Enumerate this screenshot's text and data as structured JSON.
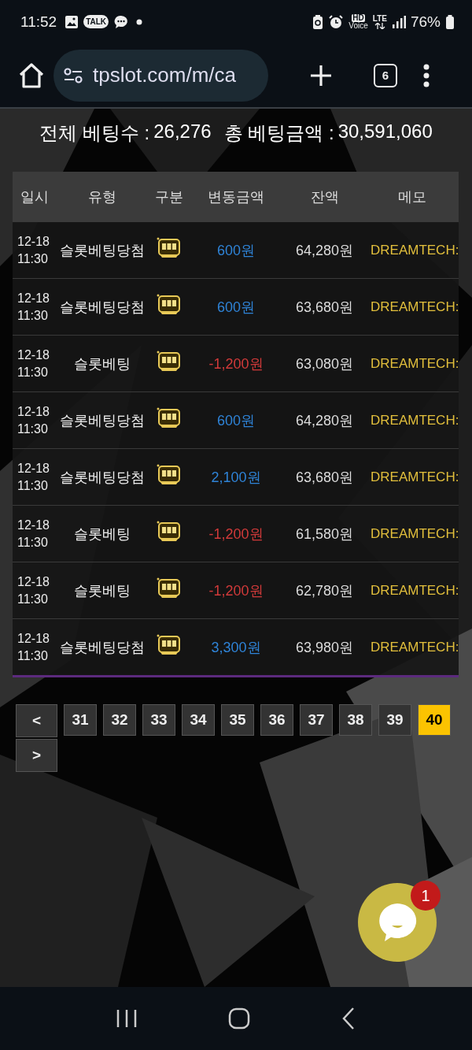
{
  "status_bar": {
    "time": "11:52",
    "talk_badge": "TALK",
    "hd_label": "HD",
    "voice_label": "Voice",
    "network": "LTE",
    "battery": "76%"
  },
  "browser": {
    "url": "tpslot.com/m/ca",
    "tab_count": "6"
  },
  "summary": {
    "total_bets_label": "전체 베팅수 :",
    "total_bets": "26,276",
    "total_amount_label": "총 베팅금액 :",
    "total_amount": "30,591,060"
  },
  "table": {
    "columns": [
      "일시",
      "유형",
      "구분",
      "변동금액",
      "잔액",
      "메모"
    ],
    "rows": [
      {
        "datetime": "12-18 11:30",
        "type": "슬롯베팅당첨",
        "amount": "600원",
        "kind": "credit",
        "balance": "64,280원",
        "memo": "DREAMTECH:"
      },
      {
        "datetime": "12-18 11:30",
        "type": "슬롯베팅당첨",
        "amount": "600원",
        "kind": "credit",
        "balance": "63,680원",
        "memo": "DREAMTECH:"
      },
      {
        "datetime": "12-18 11:30",
        "type": "슬롯베팅",
        "amount": "-1,200원",
        "kind": "debit",
        "balance": "63,080원",
        "memo": "DREAMTECH:"
      },
      {
        "datetime": "12-18 11:30",
        "type": "슬롯베팅당첨",
        "amount": "600원",
        "kind": "credit",
        "balance": "64,280원",
        "memo": "DREAMTECH:"
      },
      {
        "datetime": "12-18 11:30",
        "type": "슬롯베팅당첨",
        "amount": "2,100원",
        "kind": "credit",
        "balance": "63,680원",
        "memo": "DREAMTECH:"
      },
      {
        "datetime": "12-18 11:30",
        "type": "슬롯베팅",
        "amount": "-1,200원",
        "kind": "debit",
        "balance": "61,580원",
        "memo": "DREAMTECH:"
      },
      {
        "datetime": "12-18 11:30",
        "type": "슬롯베팅",
        "amount": "-1,200원",
        "kind": "debit",
        "balance": "62,780원",
        "memo": "DREAMTECH:"
      },
      {
        "datetime": "12-18 11:30",
        "type": "슬롯베팅당첨",
        "amount": "3,300원",
        "kind": "credit",
        "balance": "63,980원",
        "memo": "DREAMTECH:"
      }
    ]
  },
  "pagination": {
    "prev": "<",
    "next": ">",
    "pages": [
      {
        "label": "31",
        "selected": false
      },
      {
        "label": "32",
        "selected": false
      },
      {
        "label": "33",
        "selected": false
      },
      {
        "label": "34",
        "selected": false
      },
      {
        "label": "35",
        "selected": false
      },
      {
        "label": "36",
        "selected": false
      },
      {
        "label": "37",
        "selected": false
      },
      {
        "label": "38",
        "selected": false
      },
      {
        "label": "39",
        "selected": false
      },
      {
        "label": "40",
        "selected": true
      }
    ]
  },
  "chat": {
    "badge": "1"
  }
}
